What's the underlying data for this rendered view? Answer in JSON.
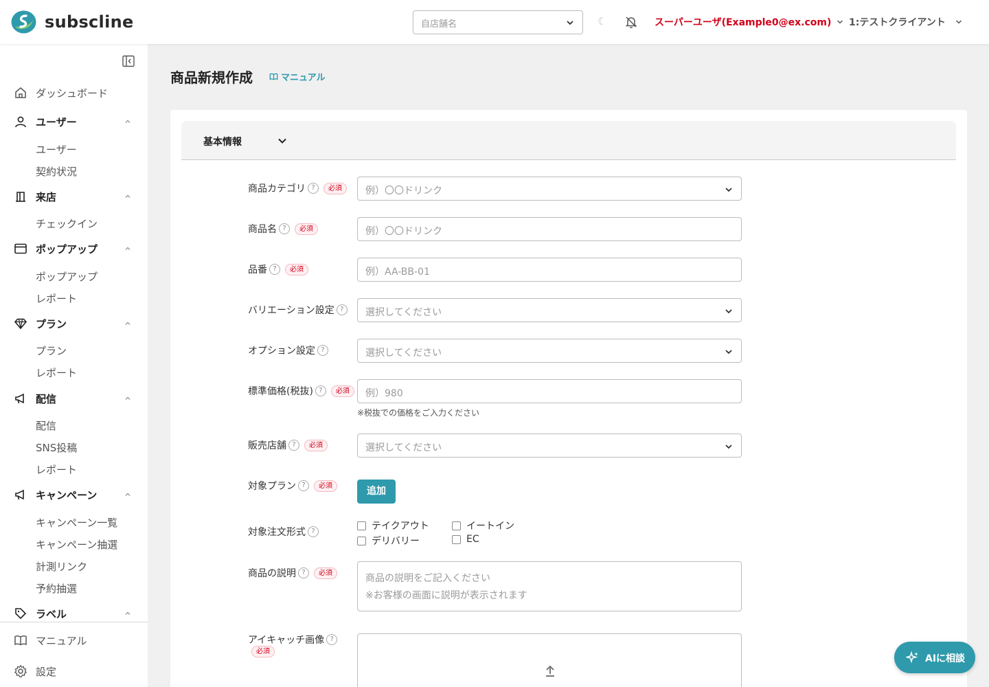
{
  "app": {
    "name": "subscline"
  },
  "header": {
    "store_placeholder": "自店舗名",
    "user_label": "スーパーユーザ(Example0@ex.com)",
    "client_label": "1:テストクライアント",
    "brand_color": "#2e9aac",
    "user_color": "#d0021b"
  },
  "sidebar": {
    "items": [
      {
        "label": "ダッシュボード",
        "icon": "home-icon",
        "group": false
      },
      {
        "label": "ユーザー",
        "icon": "user-icon",
        "group": true,
        "children": [
          "ユーザー",
          "契約状況"
        ]
      },
      {
        "label": "来店",
        "icon": "store-icon",
        "group": true,
        "children": [
          "チェックイン"
        ]
      },
      {
        "label": "ポップアップ",
        "icon": "browser-window-icon",
        "group": true,
        "children": [
          "ポップアップ",
          "レポート"
        ]
      },
      {
        "label": "プラン",
        "icon": "diamond-icon",
        "group": true,
        "children": [
          "プラン",
          "レポート"
        ]
      },
      {
        "label": "配信",
        "icon": "megaphone-icon",
        "group": true,
        "children": [
          "配信",
          "SNS投稿",
          "レポート"
        ]
      },
      {
        "label": "キャンペーン",
        "icon": "megaphone-icon",
        "group": true,
        "children": [
          "キャンペーン一覧",
          "キャンペーン抽選",
          "計測リンク",
          "予約抽選"
        ]
      },
      {
        "label": "ラベル",
        "icon": "tag-icon",
        "group": true,
        "children": []
      }
    ],
    "footer": [
      {
        "label": "マニュアル",
        "icon": "book-icon"
      },
      {
        "label": "設定",
        "icon": "gear-icon"
      }
    ]
  },
  "page": {
    "title": "商品新規作成",
    "manual_link": "マニュアル",
    "section_title": "基本情報",
    "required_badge": "必須",
    "help_glyph": "?"
  },
  "form": {
    "category": {
      "label": "商品カテゴリ",
      "placeholder": "例）〇〇ドリンク"
    },
    "name": {
      "label": "商品名",
      "placeholder": "例）〇〇ドリンク"
    },
    "sku": {
      "label": "品番",
      "placeholder": "例）AA-BB-01"
    },
    "variation": {
      "label": "バリエーション設定",
      "placeholder": "選択してください"
    },
    "option": {
      "label": "オプション設定",
      "placeholder": "選択してください"
    },
    "price": {
      "label": "標準価格(税抜)",
      "placeholder": "例）980",
      "hint": "※税抜での価格をご入力ください"
    },
    "stores": {
      "label": "販売店舗",
      "placeholder": "選択してください"
    },
    "plans": {
      "label": "対象プラン",
      "button": "追加"
    },
    "order_types": {
      "label": "対象注文形式",
      "options": [
        "テイクアウト",
        "イートイン",
        "デリバリー",
        "EC"
      ]
    },
    "description": {
      "label": "商品の説明",
      "placeholder_line1": "商品の説明をご記入ください",
      "placeholder_line2": "※お客様の画面に説明が表示されます"
    },
    "eyecatch": {
      "label": "アイキャッチ画像"
    }
  },
  "ai_button": {
    "label": "AIに相談"
  }
}
